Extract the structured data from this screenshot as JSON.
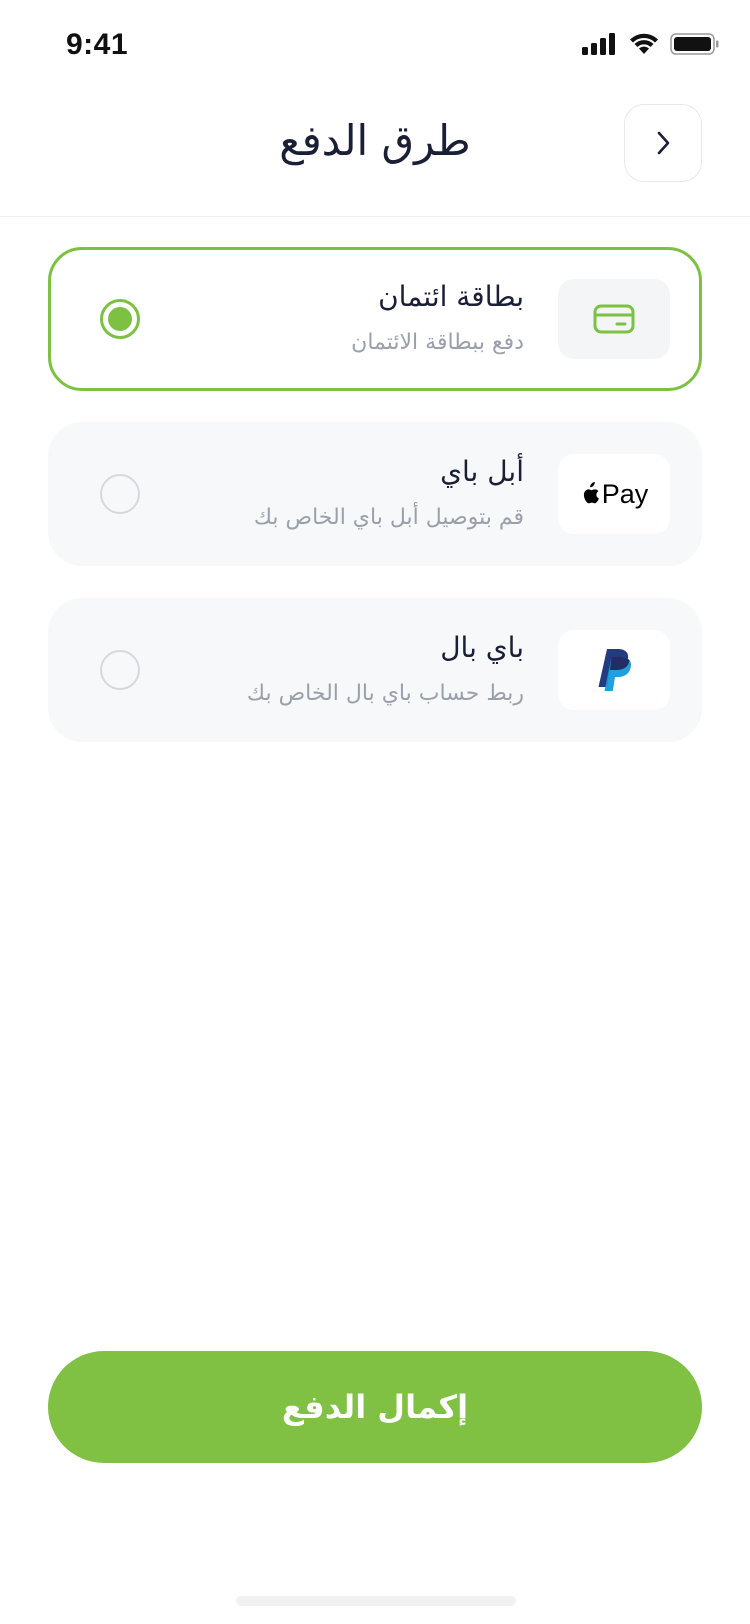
{
  "status_bar": {
    "time": "9:41"
  },
  "header": {
    "title": "طرق الدفع",
    "back_icon": "chevron-right-icon"
  },
  "payment_options": [
    {
      "title": "بطاقة ائتمان",
      "subtitle": "دفع ببطاقة الائتمان",
      "icon": "credit-card-icon",
      "selected": true
    },
    {
      "title": "أبل باي",
      "subtitle": "قم بتوصيل أبل باي الخاص بك",
      "icon": "apple-pay-logo",
      "logo_text": "Pay",
      "selected": false
    },
    {
      "title": "باي بال",
      "subtitle": "ربط حساب باي بال الخاص بك",
      "icon": "paypal-logo",
      "selected": false
    }
  ],
  "primary_button": {
    "label": "إكمال الدفع"
  },
  "colors": {
    "accent": "#80c143",
    "selected_border": "#7dc142",
    "card_background": "#f7f8fa",
    "title_text": "#1a1f36",
    "subtitle_text": "#9aa0ab"
  }
}
